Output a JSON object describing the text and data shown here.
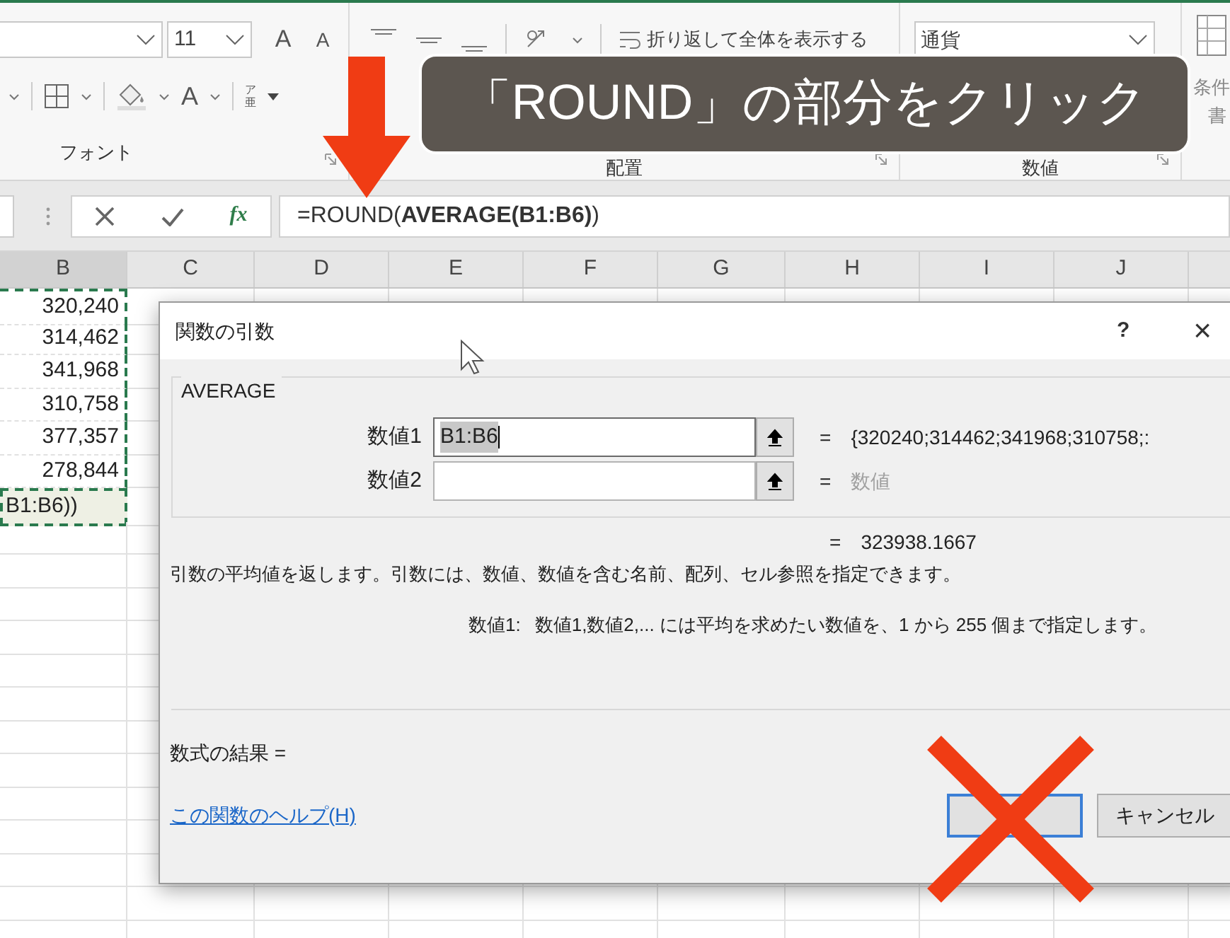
{
  "ribbon": {
    "font_size": "11",
    "grow_font": "A",
    "shrink_font": "A",
    "font_color": "A",
    "phonetic": [
      "ア",
      "亜"
    ],
    "wrap_text": "折り返して全体を表示する",
    "number_format": "通貨",
    "styles_top": "条件",
    "styles_bottom": "書",
    "groups": [
      {
        "label": "フォント"
      },
      {
        "label": "配置"
      },
      {
        "label": "数値"
      }
    ]
  },
  "formula_bar": {
    "function_button": "fx",
    "formula": "=ROUND(**AVERAGE(B1:B6)**)"
  },
  "sheet": {
    "columns": [
      "B",
      "C",
      "D",
      "E",
      "F",
      "G",
      "H",
      "I",
      "J"
    ],
    "cells": [
      "320,240",
      "314,462",
      "341,968",
      "310,758",
      "377,357",
      "278,844"
    ],
    "editing_cell": "B1:B6))"
  },
  "dialog": {
    "title": "関数の引数",
    "help": "?",
    "close": "×",
    "function_name": "AVERAGE",
    "arguments": [
      {
        "label": "数値1",
        "value": "B1:B6",
        "text_selected": true,
        "equals": "=",
        "result": "{320240;314462;341968;310758;:",
        "result_muted": false
      },
      {
        "label": "数値2",
        "text_selected": false,
        "equals": "=",
        "result": "数値",
        "result_muted": true
      }
    ],
    "total_equals": "=",
    "total": "323938.1667",
    "description": "引数の平均値を返します。引数には、数値、数値を含む名前、配列、セル参照を指定できます。",
    "argument_name": "数値1:",
    "argument_help": "数値1,数値2,... には平均を求めたい数値を、1 から 255 個まで指定します。",
    "result_label": "数式の結果 =",
    "help_link": "この関数のヘルプ(H)",
    "ok_button": {
      "focused": true
    },
    "cancel_button": "キャンセル"
  },
  "callout": {
    "text": "「ROUND」の部分をクリック"
  }
}
